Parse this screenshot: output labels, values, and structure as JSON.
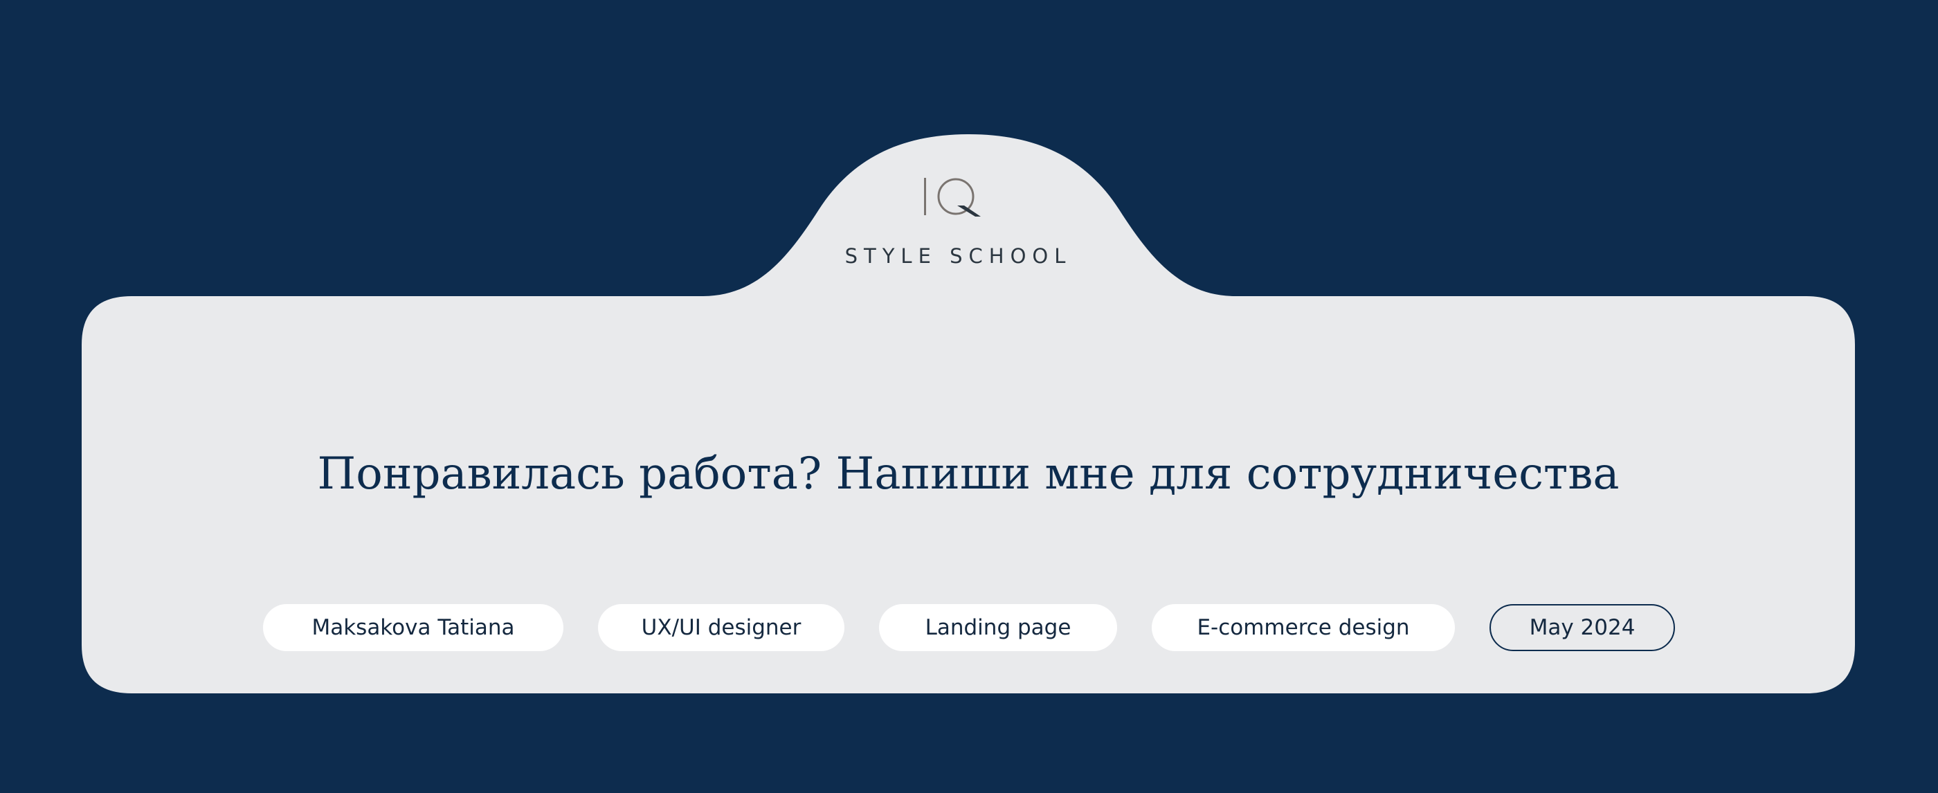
{
  "brand": {
    "mark": "IQ",
    "name": "STYLE SCHOOL"
  },
  "headline": "Понравилась работа? Напиши мне для сотрудничества",
  "tags": [
    "Maksakova Tatiana",
    "UX/UI designer",
    "Landing page",
    "E-commerce design",
    "May 2024"
  ],
  "colors": {
    "background": "#0d2c4e",
    "card": "#e9eaec",
    "pill": "#ffffff",
    "text": "#0d2c4e"
  }
}
